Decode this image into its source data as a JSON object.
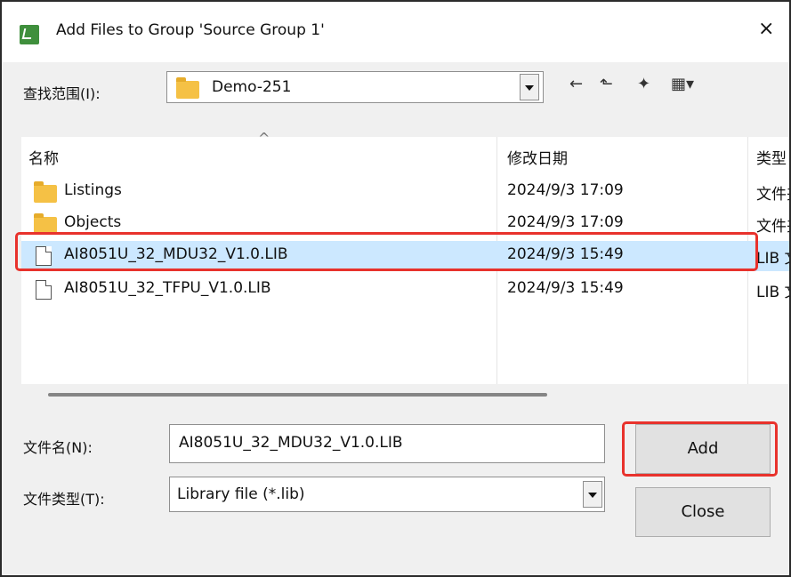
{
  "title": "Add Files to Group 'Source Group 1'",
  "close_label": "×",
  "lookin": {
    "label": "查找范围(I):",
    "value": "Demo-251"
  },
  "toolbar": {
    "back": "←",
    "up": "⬑",
    "newfolder": "✦",
    "view": "▦▾"
  },
  "columns": {
    "sort": "^",
    "name": "名称",
    "date": "修改日期",
    "type": "类型"
  },
  "files": [
    {
      "name": "Listings",
      "date": "2024/9/3 17:09",
      "type": "文件夹"
    },
    {
      "name": "Objects",
      "date": "2024/9/3 17:09",
      "type": "文件夹"
    },
    {
      "name": "AI8051U_32_MDU32_V1.0.LIB",
      "date": "2024/9/3 15:49",
      "type": "LIB 文件"
    },
    {
      "name": "AI8051U_32_TFPU_V1.0.LIB",
      "date": "2024/9/3 15:49",
      "type": "LIB 文件"
    }
  ],
  "filename": {
    "label": "文件名(N):",
    "value": "AI8051U_32_MDU32_V1.0.LIB"
  },
  "filetype": {
    "label": "文件类型(T):",
    "value": "Library file (*.lib)"
  },
  "buttons": {
    "add": "Add",
    "close": "Close"
  },
  "colors": {
    "highlight": "#e8322c",
    "selection": "#cce8ff"
  }
}
